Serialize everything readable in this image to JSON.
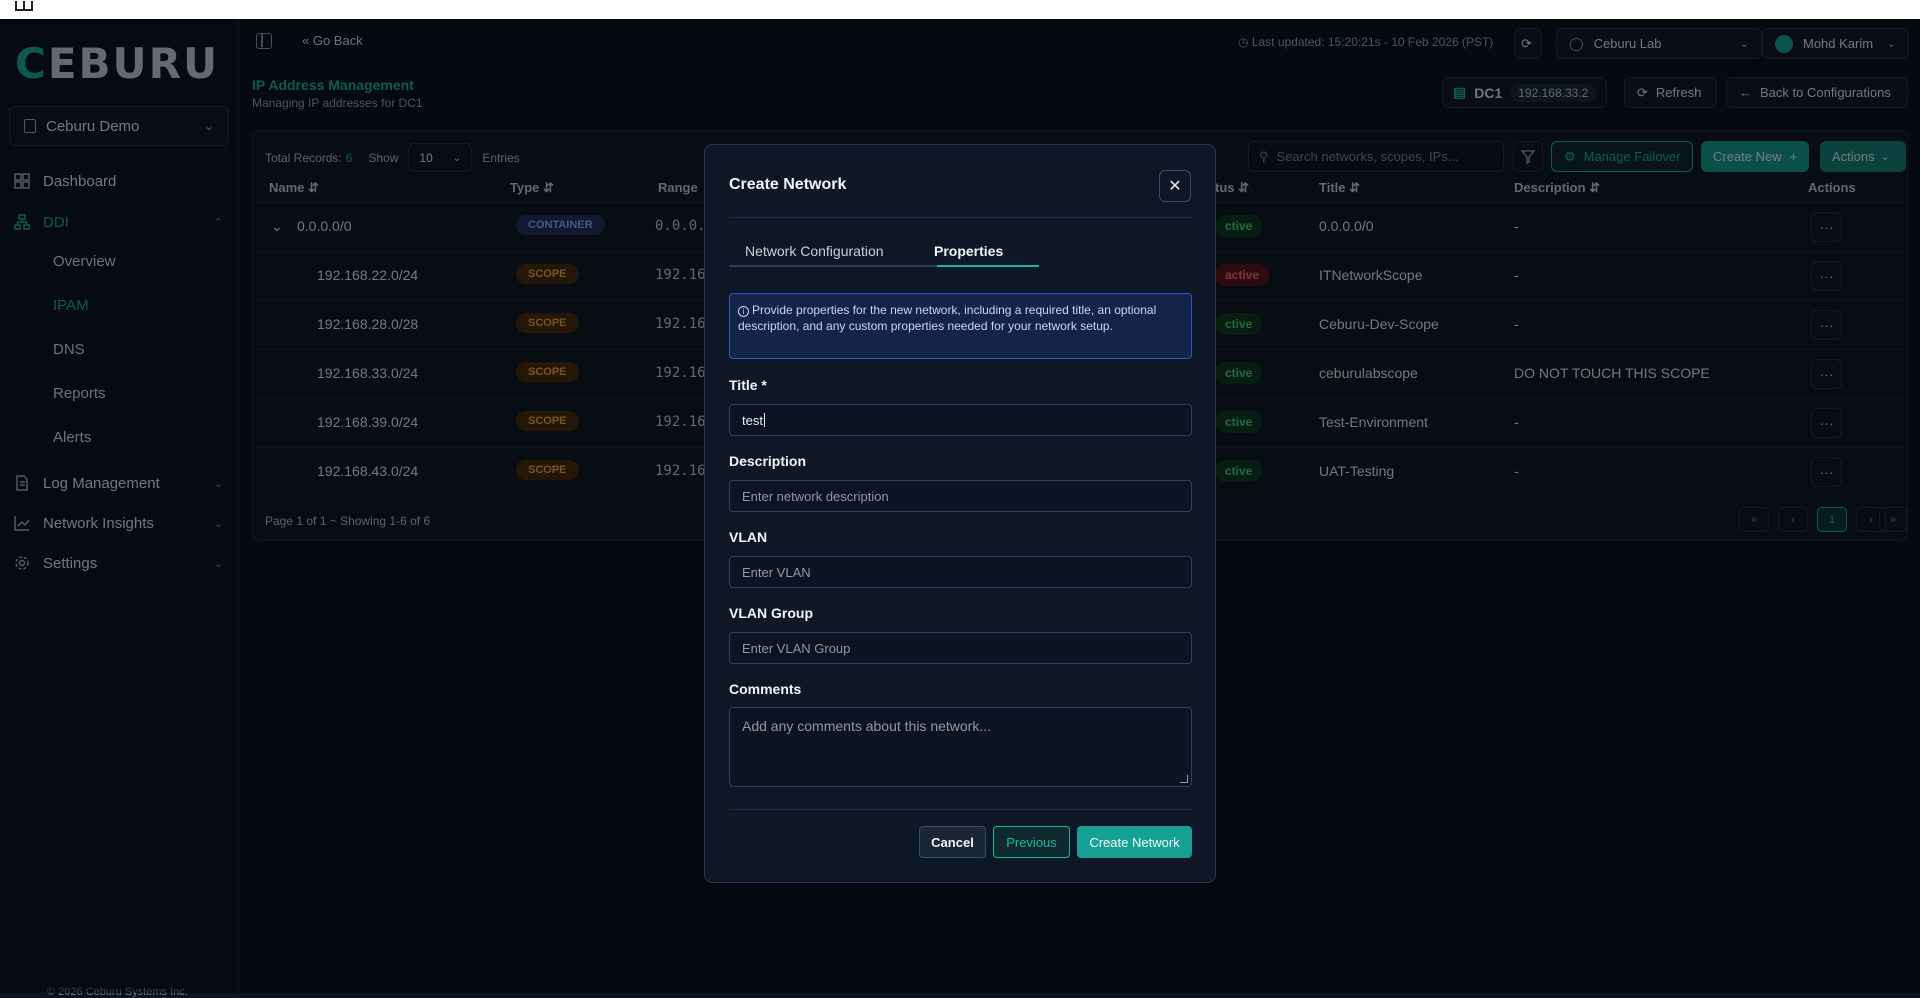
{
  "sidebar": {
    "logo": "CEBURU",
    "org": "Ceburu Demo",
    "items": {
      "dashboard": "Dashboard",
      "ddi": "DDI",
      "overview": "Overview",
      "ipam": "IPAM",
      "dns": "DNS",
      "reports": "Reports",
      "alerts": "Alerts",
      "log_management": "Log Management",
      "network_insights": "Network Insights",
      "settings": "Settings"
    },
    "copyright": "© 2026 Ceburu Systems Inc."
  },
  "header": {
    "go_back": "Go Back",
    "last_updated": "Last updated: 15:20:21s - 10 Feb 2026 (PST)",
    "lab": "Ceburu Lab",
    "user": "Mohd Karim",
    "page_title": "IP Address Management",
    "page_subtitle": "Managing IP addresses for DC1",
    "dc_name": "DC1",
    "dc_ip": "192.168.33.2",
    "refresh": "Refresh",
    "back_to_config": "Back to Configurations"
  },
  "table": {
    "total_label": "Total Records:",
    "total": "6",
    "show": "Show",
    "page_size": "10",
    "entries": "Entries",
    "search_placeholder": "Search networks, scopes, IPs...",
    "manage_failover": "Manage Failover",
    "create_new": "Create New",
    "actions_btn": "Actions",
    "columns": {
      "name": "Name",
      "type": "Type",
      "range": "Range",
      "status": "tus",
      "title": "Title",
      "description": "Description",
      "actions": "Actions"
    },
    "rows": [
      {
        "name": "0.0.0.0/0",
        "type": "CONTAINER",
        "range": "0.0.0.",
        "status": "ctive",
        "title": "0.0.0.0/0",
        "description": "-"
      },
      {
        "name": "192.168.22.0/24",
        "type": "SCOPE",
        "range": "192.16",
        "status": "active",
        "title": "ITNetworkScope",
        "description": "-"
      },
      {
        "name": "192.168.28.0/28",
        "type": "SCOPE",
        "range": "192.16",
        "status": "ctive",
        "title": "Ceburu-Dev-Scope",
        "description": "-"
      },
      {
        "name": "192.168.33.0/24",
        "type": "SCOPE",
        "range": "192.16",
        "status": "ctive",
        "title": "ceburulabscope",
        "description": "DO NOT TOUCH THIS SCOPE"
      },
      {
        "name": "192.168.39.0/24",
        "type": "SCOPE",
        "range": "192.16",
        "status": "ctive",
        "title": "Test-Environment",
        "description": "-"
      },
      {
        "name": "192.168.43.0/24",
        "type": "SCOPE",
        "range": "192.16",
        "status": "ctive",
        "title": "UAT-Testing",
        "description": "-"
      }
    ],
    "page_text": "Page 1 of 1 ~ Showing 1-6 of 6",
    "current_page": "1"
  },
  "modal": {
    "title": "Create Network",
    "tab_config": "Network Configuration",
    "tab_properties": "Properties",
    "info": "Provide properties for the new network, including a required title, an optional description, and any custom properties needed for your network setup.",
    "title_label": "Title *",
    "title_value": "test",
    "description_label": "Description",
    "description_placeholder": "Enter network description",
    "vlan_label": "VLAN",
    "vlan_placeholder": "Enter VLAN",
    "vlan_group_label": "VLAN Group",
    "vlan_group_placeholder": "Enter VLAN Group",
    "comments_label": "Comments",
    "comments_placeholder": "Add any comments about this network...",
    "cancel": "Cancel",
    "previous": "Previous",
    "create": "Create Network"
  },
  "colors": {
    "accent": "#18b6a8",
    "background": "#0b1220",
    "scope_badge": "#f0a640",
    "container_badge": "#8fb0ff",
    "active_status": "#46d27e",
    "inactive_status": "#ff6b7a"
  }
}
